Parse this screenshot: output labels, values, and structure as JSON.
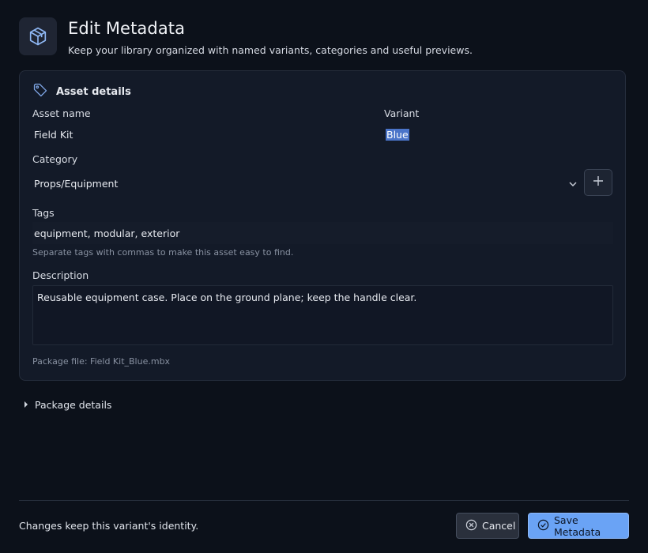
{
  "header": {
    "title": "Edit Metadata",
    "subtitle": "Keep your library organized with named variants, categories and useful previews."
  },
  "asset_details": {
    "title": "Asset details",
    "asset_name_label": "Asset name",
    "asset_name_value": "Field Kit",
    "variant_label": "Variant",
    "variant_value": "Blue",
    "category_label": "Category",
    "category_value": "Props/Equipment",
    "tags_label": "Tags",
    "tags_value": "equipment, modular, exterior",
    "tags_hint": "Separate tags with commas to make this asset easy to find.",
    "description_label": "Description",
    "description_value": "Reusable equipment case. Place on the ground plane; keep the handle clear.",
    "package_file": "Package file: Field Kit_Blue.mbx"
  },
  "package_details": {
    "label": "Package details",
    "expanded": false
  },
  "footer": {
    "note": "Changes keep this variant's identity.",
    "cancel_label": "Cancel",
    "save_label": "Save Metadata"
  },
  "colors": {
    "background": "#0c111a",
    "card": "#131a28",
    "accent": "#6aa3f5",
    "selection": "#4a74c9"
  },
  "icons": {
    "header": "package-icon",
    "card": "tag-icon",
    "category_dropdown": "chevron-down-icon",
    "add_category": "plus-icon",
    "package_toggle": "caret-right-icon",
    "cancel": "close-circle-icon",
    "save": "check-circle-icon"
  }
}
